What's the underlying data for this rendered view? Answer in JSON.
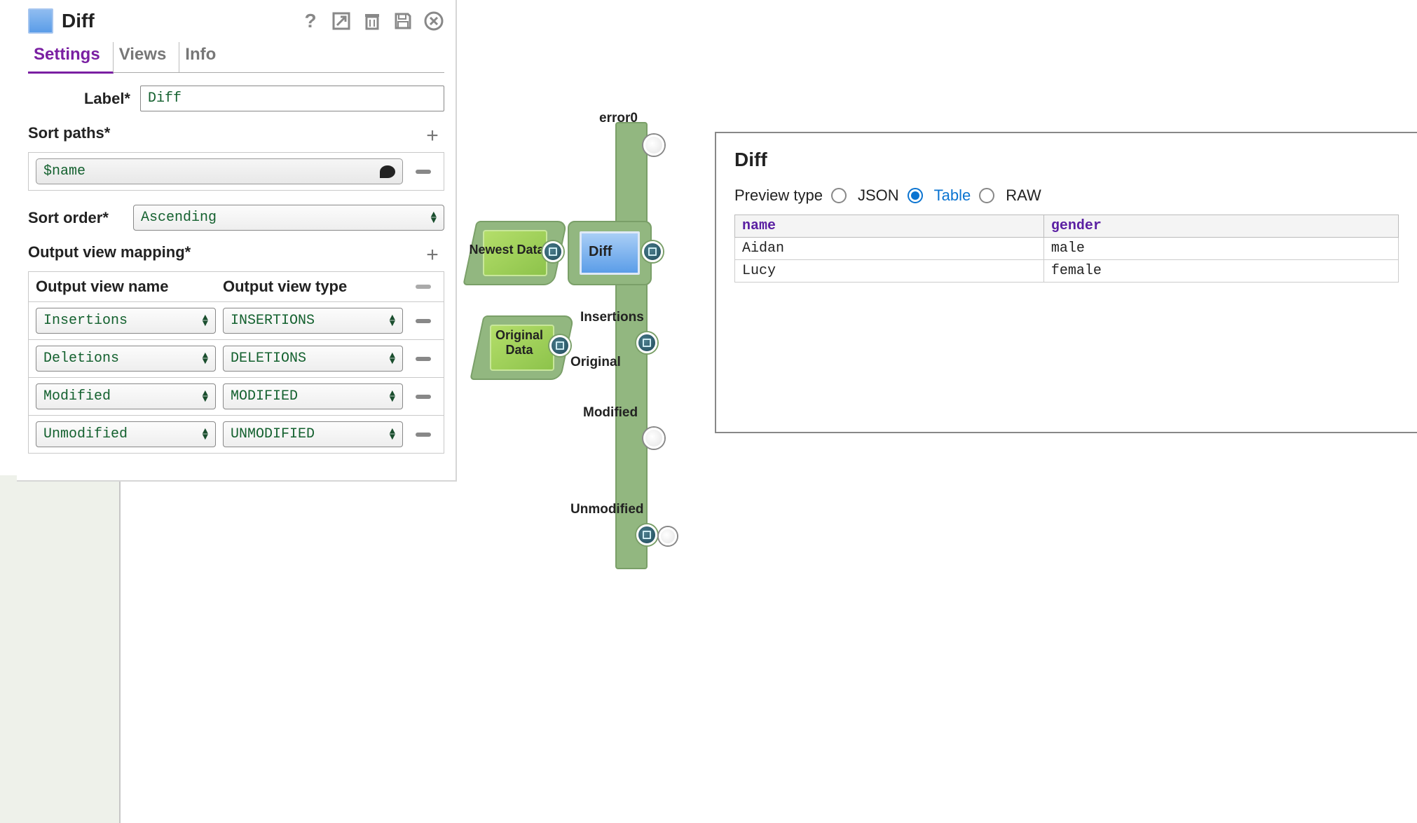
{
  "panel": {
    "title": "Diff",
    "tabs": [
      "Settings",
      "Views",
      "Info"
    ],
    "active_tab": 0,
    "label_field": {
      "label": "Label*",
      "value": "Diff"
    },
    "sort_paths": {
      "label": "Sort paths*",
      "items": [
        "$name"
      ]
    },
    "sort_order": {
      "label": "Sort order*",
      "value": "Ascending"
    },
    "output_mapping": {
      "label": "Output view mapping*",
      "columns": [
        "Output view name",
        "Output view type"
      ],
      "rows": [
        {
          "name": "Insertions",
          "type": "INSERTIONS"
        },
        {
          "name": "Deletions",
          "type": "DELETIONS"
        },
        {
          "name": "Modified",
          "type": "MODIFIED"
        },
        {
          "name": "Unmodified",
          "type": "UNMODIFIED"
        }
      ]
    }
  },
  "pipeline": {
    "diff_label": "Diff",
    "inputs": [
      {
        "label": "Newest Data"
      },
      {
        "label": "Original Data"
      }
    ],
    "outputs": [
      {
        "label": "error0"
      },
      {
        "label": "Insertions"
      },
      {
        "label": "Original"
      },
      {
        "label": "Modified"
      },
      {
        "label": "Unmodified"
      }
    ]
  },
  "preview": {
    "title": "Diff",
    "type_label": "Preview type",
    "options": [
      "JSON",
      "Table",
      "RAW"
    ],
    "selected": 1,
    "columns": [
      "name",
      "gender"
    ],
    "rows": [
      {
        "name": "Aidan",
        "gender": "male"
      },
      {
        "name": "Lucy",
        "gender": "female"
      }
    ]
  }
}
